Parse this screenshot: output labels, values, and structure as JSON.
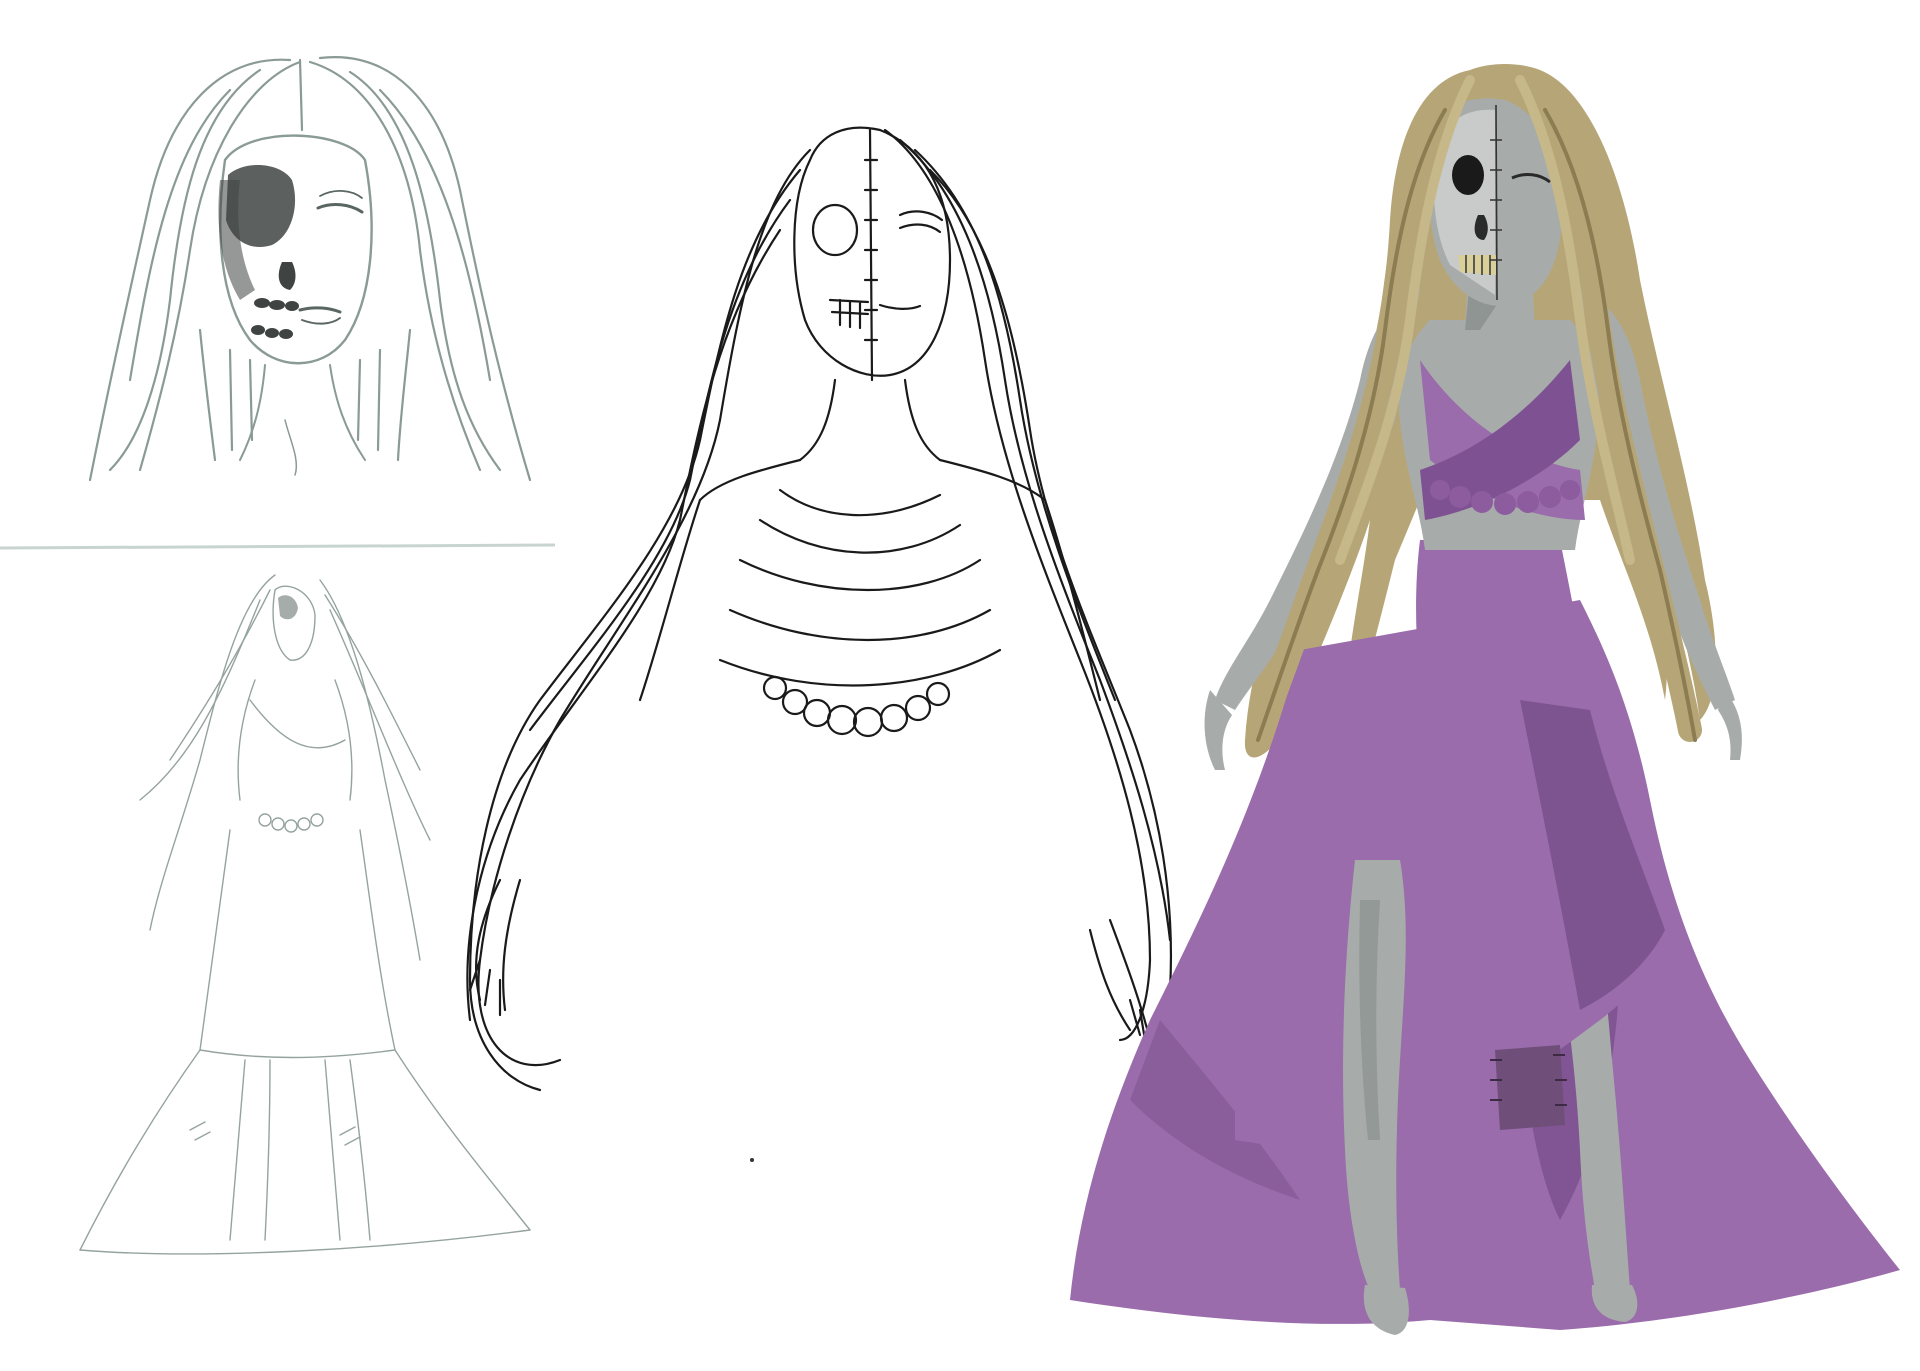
{
  "colors": {
    "background": "#ffffff",
    "pencil_line": "#8a9a94",
    "pencil_shade": "#3f4442",
    "ink_line": "#1a1a1a",
    "skin_grey": "#a7acaa",
    "skin_shadow": "#7f8584",
    "hair_blonde": "#b6a677",
    "hair_shadow": "#8c7c52",
    "dress_purple": "#9a6cab",
    "dress_shadow": "#6d447f",
    "patch_purple": "#6f4f7a",
    "divider": "#c8d4d0"
  },
  "panels": {
    "sketch_head": "pencil-head-study",
    "sketch_full": "pencil-full-figure-study",
    "lineart": "lineart-bust",
    "color": "colored-full-figure"
  }
}
